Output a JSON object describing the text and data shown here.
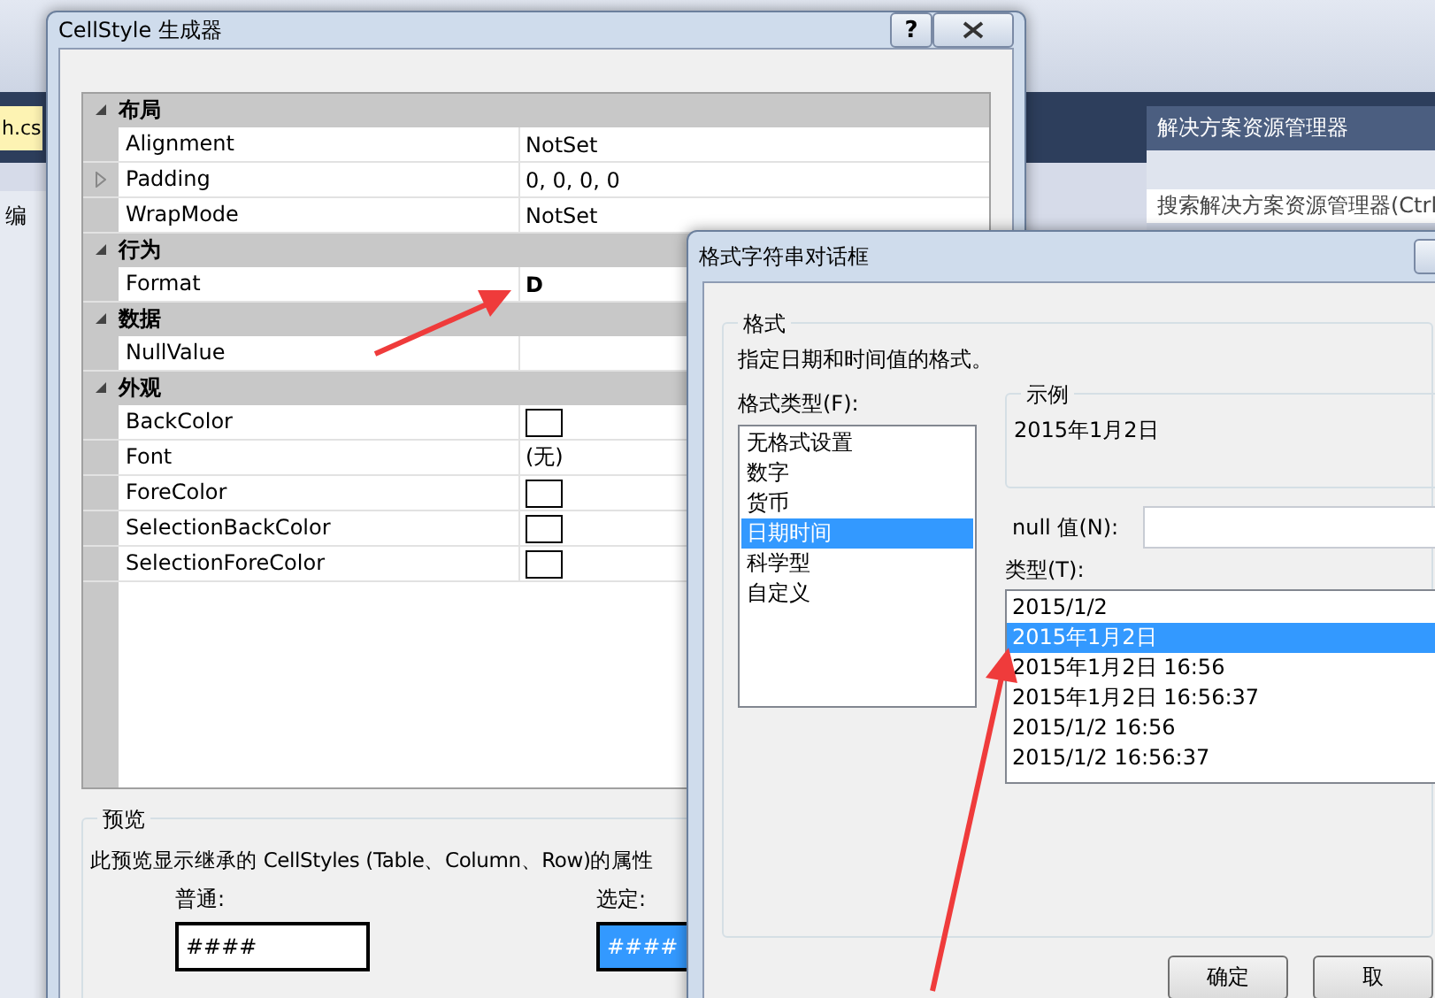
{
  "ide": {
    "tab": "h.cs",
    "left_tab": "编",
    "explorer_title": "解决方案资源管理器",
    "explorer_search": "搜索解决方案资源管理器(Ctrl"
  },
  "cellstyle_dialog": {
    "title": "CellStyle 生成器",
    "help": "?",
    "categories": [
      {
        "name": "布局",
        "expanded": true,
        "properties": [
          {
            "name": "Alignment",
            "kind": "text",
            "value": "NotSet",
            "expandable": false,
            "modified": false
          },
          {
            "name": "Padding",
            "kind": "text",
            "value": "0, 0, 0, 0",
            "expandable": true,
            "modified": false
          },
          {
            "name": "WrapMode",
            "kind": "text",
            "value": "NotSet",
            "expandable": false,
            "modified": false
          }
        ]
      },
      {
        "name": "行为",
        "expanded": true,
        "properties": [
          {
            "name": "Format",
            "kind": "text",
            "value": "D",
            "expandable": false,
            "modified": true
          }
        ]
      },
      {
        "name": "数据",
        "expanded": true,
        "properties": [
          {
            "name": "NullValue",
            "kind": "text",
            "expandable": false
          }
        ]
      },
      {
        "name": "外观",
        "expanded": true,
        "properties": [
          {
            "name": "BackColor",
            "kind": "color",
            "expandable": false
          },
          {
            "name": "Font",
            "kind": "text",
            "value": "(无)",
            "expandable": false,
            "modified": false
          },
          {
            "name": "ForeColor",
            "kind": "color",
            "expandable": false
          },
          {
            "name": "SelectionBackColor",
            "kind": "color",
            "expandable": false
          },
          {
            "name": "SelectionForeColor",
            "kind": "color",
            "expandable": false
          }
        ]
      }
    ],
    "preview": {
      "title": "预览",
      "description": "此预览显示继承的 CellStyles (Table、Column、Row)的属性",
      "normal_label": "普通:",
      "normal_sample": "####",
      "selected_label": "选定:",
      "selected_sample": "####"
    }
  },
  "format_dialog": {
    "title": "格式字符串对话框",
    "group_title": "格式",
    "description": "指定日期和时间值的格式。",
    "format_type_label": "格式类型(F):",
    "format_types": [
      {
        "label": "无格式设置",
        "selected": false
      },
      {
        "label": "数字",
        "selected": false
      },
      {
        "label": "货币",
        "selected": false
      },
      {
        "label": "日期时间",
        "selected": true
      },
      {
        "label": "科学型",
        "selected": false
      },
      {
        "label": "自定义",
        "selected": false
      }
    ],
    "sample_title": "示例",
    "sample_value": "2015年1月2日",
    "null_label": "null 值(N):",
    "type_label": "类型(T):",
    "types": [
      {
        "label": "2015/1/2",
        "selected": false
      },
      {
        "label": "2015年1月2日",
        "selected": true
      },
      {
        "label": "2015年1月2日 16:56",
        "selected": false
      },
      {
        "label": "2015年1月2日 16:56:37",
        "selected": false
      },
      {
        "label": "2015/1/2 16:56",
        "selected": false
      },
      {
        "label": "2015/1/2 16:56:37",
        "selected": false
      }
    ],
    "buttons": [
      "确定",
      "取"
    ]
  }
}
